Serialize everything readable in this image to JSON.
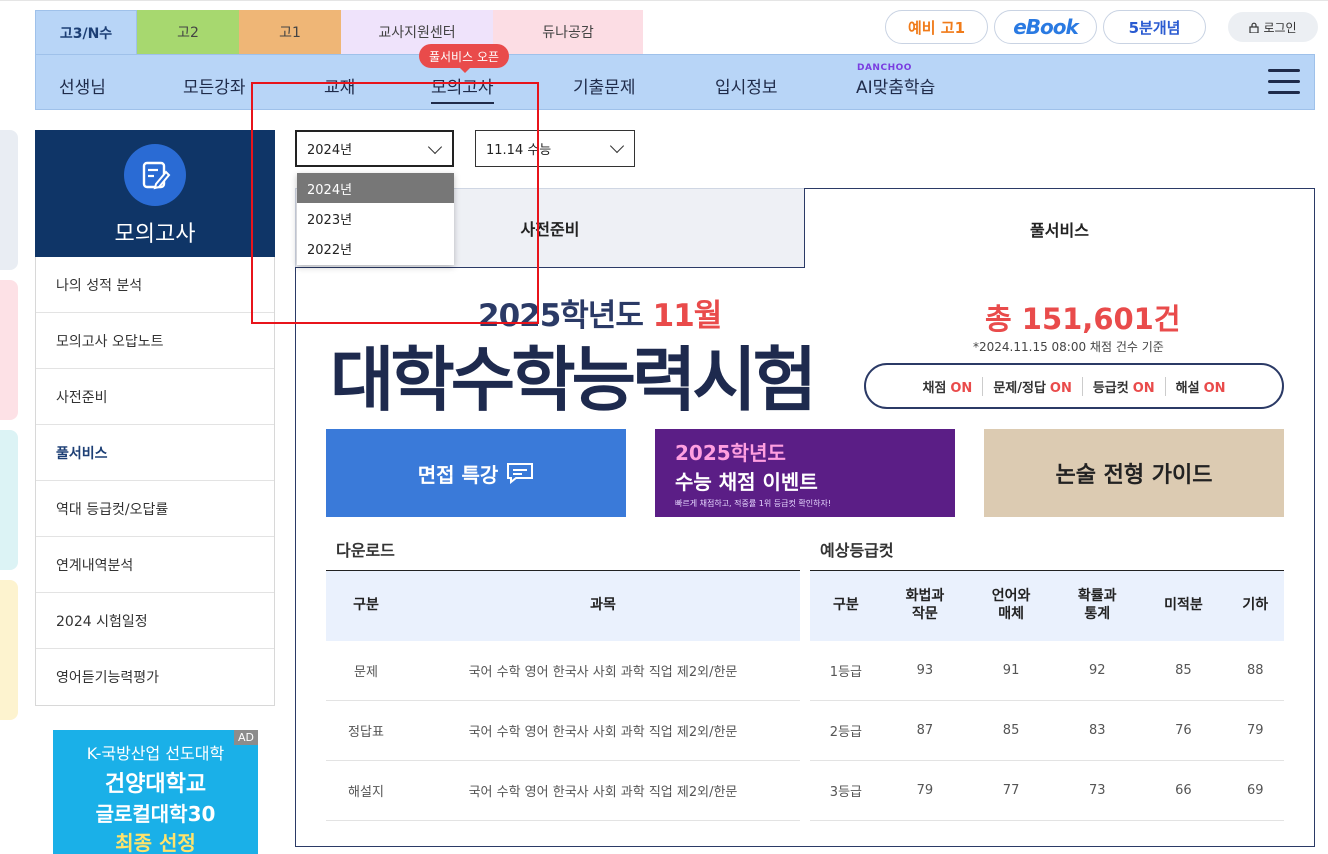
{
  "grade_tabs": [
    "고3/N수",
    "고2",
    "고1",
    "교사지원센터",
    "듀나공감"
  ],
  "top_links": {
    "pre_g1": "예비 고1",
    "ebook": "eBook",
    "basics": "5분개념",
    "login": "로그인"
  },
  "nav": {
    "items": [
      "선생님",
      "모든강좌",
      "교재",
      "모의고사",
      "기출문제",
      "입시정보",
      "AI맞춤학습"
    ],
    "badge": "풀서비스 오픈",
    "ai_brand": "DANCHOO"
  },
  "sidebar": {
    "title": "모의고사",
    "items": [
      "나의 성적 분석",
      "모의고사 오답노트",
      "사전준비",
      "풀서비스",
      "역대 등급컷/오답률",
      "연계내역분석",
      "2024 시험일정",
      "영어듣기능력평가"
    ]
  },
  "ad": {
    "tag": "AD",
    "line1": "K-국방산업 선도대학",
    "line2": "건양대학교",
    "line3": "글로컬대학30",
    "line4": "최종 선정"
  },
  "filters": {
    "year_value": "2024년",
    "exam_value": "11.14 수능",
    "year_options": [
      "2024년",
      "2023년",
      "2022년"
    ]
  },
  "content_tabs": [
    "사전준비",
    "풀서비스"
  ],
  "hero": {
    "subtitle_prefix": "2025학년도 ",
    "subtitle_month": "11월",
    "title": "대학수학능력시험",
    "total": "총 151,601건",
    "note": "*2024.11.15 08:00 채점 건수 기준",
    "status": [
      {
        "label": "채점",
        "value": "ON"
      },
      {
        "label": "문제/정답",
        "value": "ON"
      },
      {
        "label": "등급컷",
        "value": "ON"
      },
      {
        "label": "해설",
        "value": "ON"
      }
    ]
  },
  "banners": {
    "interview": "면접 특강",
    "event_year": "2025학년도",
    "event_title": "수능 채점 이벤트",
    "event_sub": "빠르게 채점하고, 적중률 1위 등급컷 확인하자!",
    "essay": "논술 전형 가이드"
  },
  "download": {
    "title": "다운로드",
    "headers": [
      "구분",
      "과목"
    ],
    "rows": [
      [
        "문제",
        "국어 수학 영어 한국사 사회 과학 직업 제2외/한문"
      ],
      [
        "정답표",
        "국어 수학 영어 한국사 사회 과학 직업 제2외/한문"
      ],
      [
        "해설지",
        "국어 수학 영어 한국사 사회 과학 직업 제2외/한문"
      ]
    ]
  },
  "grade_cut": {
    "title": "예상등급컷",
    "headers": [
      "구분",
      "화법과\n작문",
      "언어와\n매체",
      "확률과\n통계",
      "미적분",
      "기하"
    ],
    "rows": [
      [
        "1등급",
        "93",
        "91",
        "92",
        "85",
        "88"
      ],
      [
        "2등급",
        "87",
        "85",
        "83",
        "76",
        "79"
      ],
      [
        "3등급",
        "79",
        "77",
        "73",
        "66",
        "69"
      ]
    ]
  },
  "colors": {
    "navy": "#1e2a4e",
    "accent_red": "#e94b4b",
    "nav_blue": "#b8d5f7"
  }
}
